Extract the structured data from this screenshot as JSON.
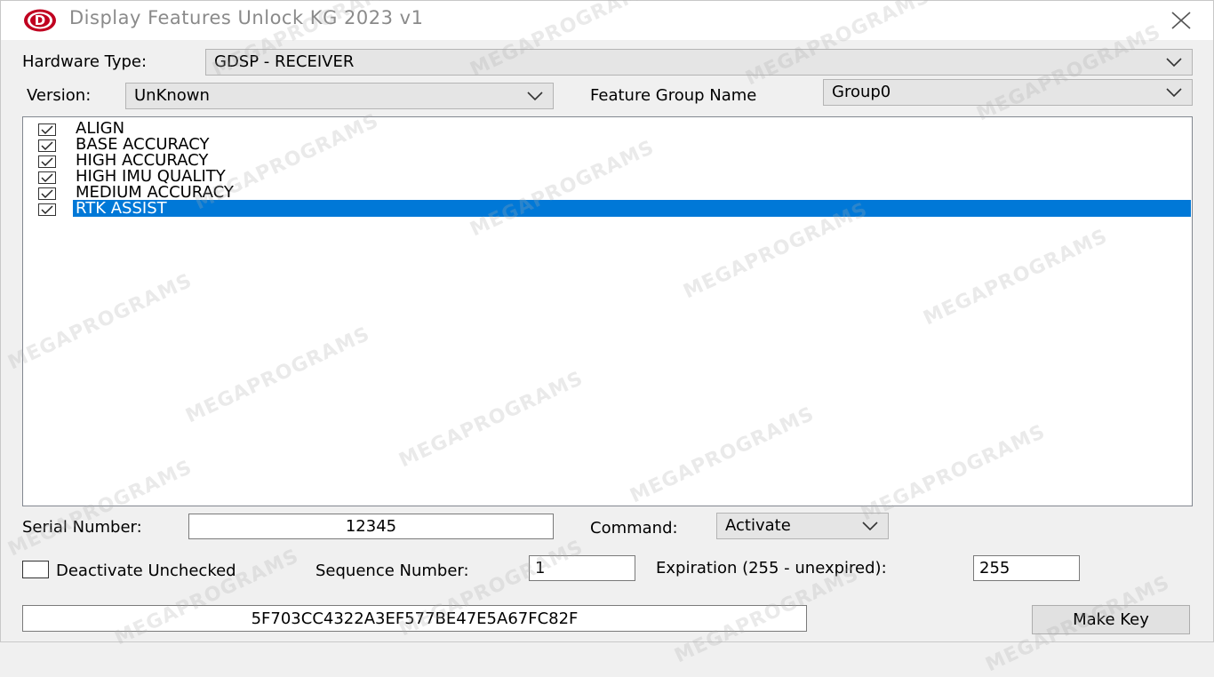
{
  "window": {
    "title": "Display Features Unlock KG 2023 v1",
    "app_icon_letter": "D",
    "accent_color": "#c00020"
  },
  "form": {
    "hardware_type_label": "Hardware Type:",
    "hardware_type_value": "GDSP - RECEIVER",
    "version_label": "Version:",
    "version_value": "UnKnown",
    "feature_group_label": "Feature Group Name",
    "feature_group_value": "Group0"
  },
  "features": [
    {
      "label": "ALIGN",
      "checked": true,
      "selected": false
    },
    {
      "label": "BASE ACCURACY",
      "checked": true,
      "selected": false
    },
    {
      "label": "HIGH ACCURACY",
      "checked": true,
      "selected": false
    },
    {
      "label": "HIGH IMU QUALITY",
      "checked": true,
      "selected": false
    },
    {
      "label": "MEDIUM ACCURACY",
      "checked": true,
      "selected": false
    },
    {
      "label": "RTK ASSIST",
      "checked": true,
      "selected": true
    }
  ],
  "bottom": {
    "serial_label": "Serial Number:",
    "serial_value": "12345",
    "command_label": "Command:",
    "command_value": "Activate",
    "deactivate_label": "Deactivate Unchecked",
    "deactivate_checked": false,
    "sequence_label": "Sequence Number:",
    "sequence_value": "1",
    "expiration_label": "Expiration (255 - unexpired):",
    "expiration_value": "255",
    "key_value": "5F703CC4322A3EF577BE47E5A67FC82F",
    "make_key_label": "Make Key"
  },
  "watermark_text": "MEGAPROGRAMS",
  "colors": {
    "selection": "#0078d7",
    "window_bg": "#f0f0f0",
    "title_text": "#8a8a8a"
  }
}
